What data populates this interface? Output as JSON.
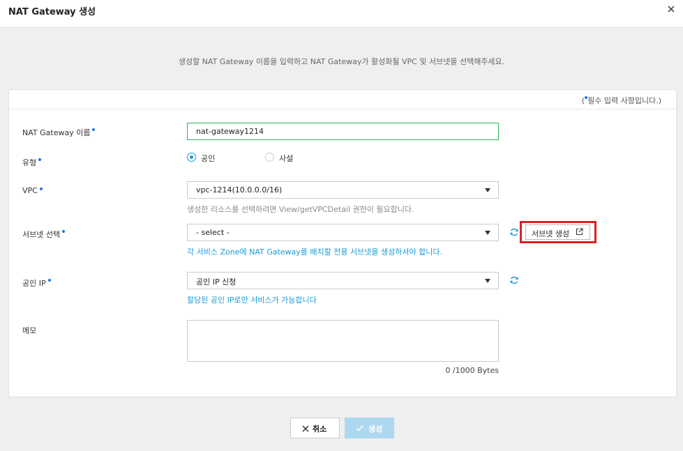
{
  "dialog": {
    "title": "NAT Gateway 생성",
    "description": "생성할 NAT Gateway 이름을 입력하고 NAT Gateway가 활성화될 VPC 및 서브넷을 선택해주세요.",
    "required_note_open": "(",
    "required_note_text": "필수 입력 사항입니다.)"
  },
  "form": {
    "name": {
      "label": "NAT Gateway 이름",
      "value": "nat-gateway1214"
    },
    "type": {
      "label": "유형",
      "options": [
        "공인",
        "사설"
      ],
      "selected": "공인"
    },
    "vpc": {
      "label": "VPC",
      "value": "vpc-1214(10.0.0.0/16)",
      "hint": "생성한 리소스를 선택하려면 View/getVPCDetail 권한이 필요합니다."
    },
    "subnet": {
      "label": "서브넷 선택",
      "value": "- select -",
      "hint": "각 서비스 Zone에 NAT Gateway를 배치할 전용 서브넷을 생성하셔야 합니다.",
      "create_button": "서브넷 생성"
    },
    "public_ip": {
      "label": "공인 IP",
      "value": "공인 IP 신청",
      "hint": "할당된 공인 IP로만 서비스가 가능합니다"
    },
    "memo": {
      "label": "메모",
      "bytes": "0 /1000 Bytes"
    }
  },
  "buttons": {
    "cancel": "취소",
    "create": "생성"
  },
  "colors": {
    "accent": "#1a9ad6",
    "highlight": "#e02020",
    "active_border": "#35b45a",
    "create_disabled": "#aed8ef"
  }
}
